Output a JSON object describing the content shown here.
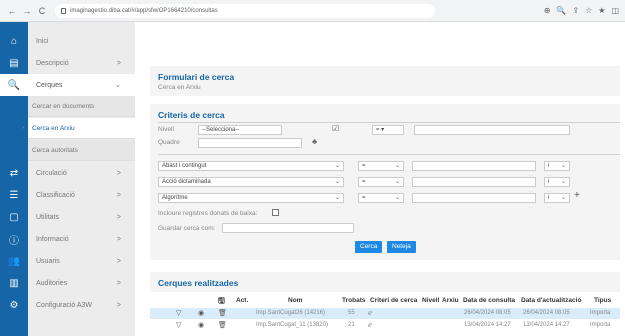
{
  "browser": {
    "back": "←",
    "forward": "→",
    "reload": "C",
    "url": "imaginagestio.diba.cat/#/app/sfw/OP1664210/consultas",
    "icons": [
      "⊕",
      "🔍",
      "⇪",
      "☆",
      "★",
      "◫"
    ]
  },
  "sidebar": {
    "items": [
      {
        "label": "Inici",
        "icon": "⌂",
        "chevron": ""
      },
      {
        "label": "Descripció",
        "icon": "▤",
        "chevron": ">"
      },
      {
        "label": "Cerques",
        "icon": "🔍",
        "chevron": "⌄"
      },
      {
        "label": "Circulació",
        "icon": "⇄",
        "chevron": ">"
      },
      {
        "label": "Classificació",
        "icon": "☰",
        "chevron": ">"
      },
      {
        "label": "Utilitats",
        "icon": "▢",
        "chevron": ">"
      },
      {
        "label": "Informació",
        "icon": "ⓘ",
        "chevron": ">"
      },
      {
        "label": "Usuaris",
        "icon": "👥",
        "chevron": ">"
      },
      {
        "label": "Auditories",
        "icon": "▥",
        "chevron": ">"
      },
      {
        "label": "Configuració A3W",
        "icon": "⚙",
        "chevron": ">"
      }
    ],
    "sub_items": [
      {
        "label": "Cercar en documents"
      },
      {
        "label": "Cerca en Arxiu"
      },
      {
        "label": "Cerca autoritats"
      }
    ]
  },
  "form": {
    "title": "Formulari de cerca",
    "subtitle": "Cerca en Arxiu",
    "criteria_title": "Criteris de cerca",
    "nivell_label": "Nivell",
    "nivell_value": "--Selecciona--",
    "quadre_label": "Quadre",
    "op_first": "= ▾",
    "criteria_rows": [
      {
        "field": "Abast i contingut",
        "op": "=",
        "logic": "i"
      },
      {
        "field": "Acció dictaminada",
        "op": "=",
        "logic": "i"
      },
      {
        "field": "Algorítme",
        "op": "=",
        "logic": "i"
      }
    ],
    "add_symbol": "+",
    "include_label": "Incloure registres donats de baixa:",
    "save_label": "Guardar cerca com:",
    "search_button": "Cerca",
    "clear_button": "Neteja"
  },
  "results": {
    "title": "Cerques realitzades",
    "columns": [
      "Act.",
      "Nom",
      "Trobats",
      "Criteri de cerca",
      "Nivell",
      "Arxiu",
      "Data de consulta",
      "Data d'actualització",
      "Tipus"
    ],
    "rows": [
      {
        "nom": "Imp.SantCugat26 (14216)",
        "trobats": "55",
        "data_consulta": "26/04/2024 08:05",
        "data_actualitzacio": "26/04/2024 08:05",
        "tipus": "Importa"
      },
      {
        "nom": "Imp.SantCugat_11 (13820)",
        "trobats": "21",
        "data_consulta": "13/04/2024 14:27",
        "data_actualitzacio": "13/04/2024 14:27",
        "tipus": "Importa"
      }
    ]
  }
}
